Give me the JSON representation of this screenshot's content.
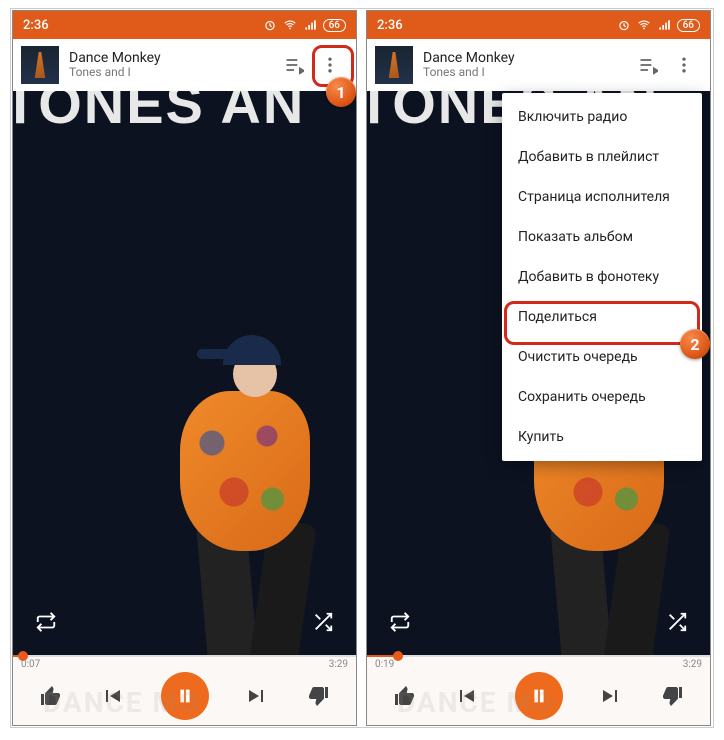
{
  "status": {
    "time": "2:36",
    "battery": "66"
  },
  "track": {
    "title": "Dance Monkey",
    "artist": "Tones and I",
    "thumb_label": "TONES AND I"
  },
  "cover": {
    "band_text": "TONES AN",
    "ghost_text": "DANCE MO"
  },
  "left": {
    "elapsed": "0:07",
    "total": "3:29",
    "progress_pct": 3
  },
  "right": {
    "elapsed": "0:19",
    "total": "3:29",
    "progress_pct": 9
  },
  "menu": {
    "items": [
      "Включить радио",
      "Добавить в плейлист",
      "Страница исполнителя",
      "Показать альбом",
      "Добавить в фонотеку",
      "Поделиться",
      "Очистить очередь",
      "Сохранить очередь",
      "Купить"
    ]
  },
  "callouts": {
    "one": "1",
    "two": "2"
  }
}
